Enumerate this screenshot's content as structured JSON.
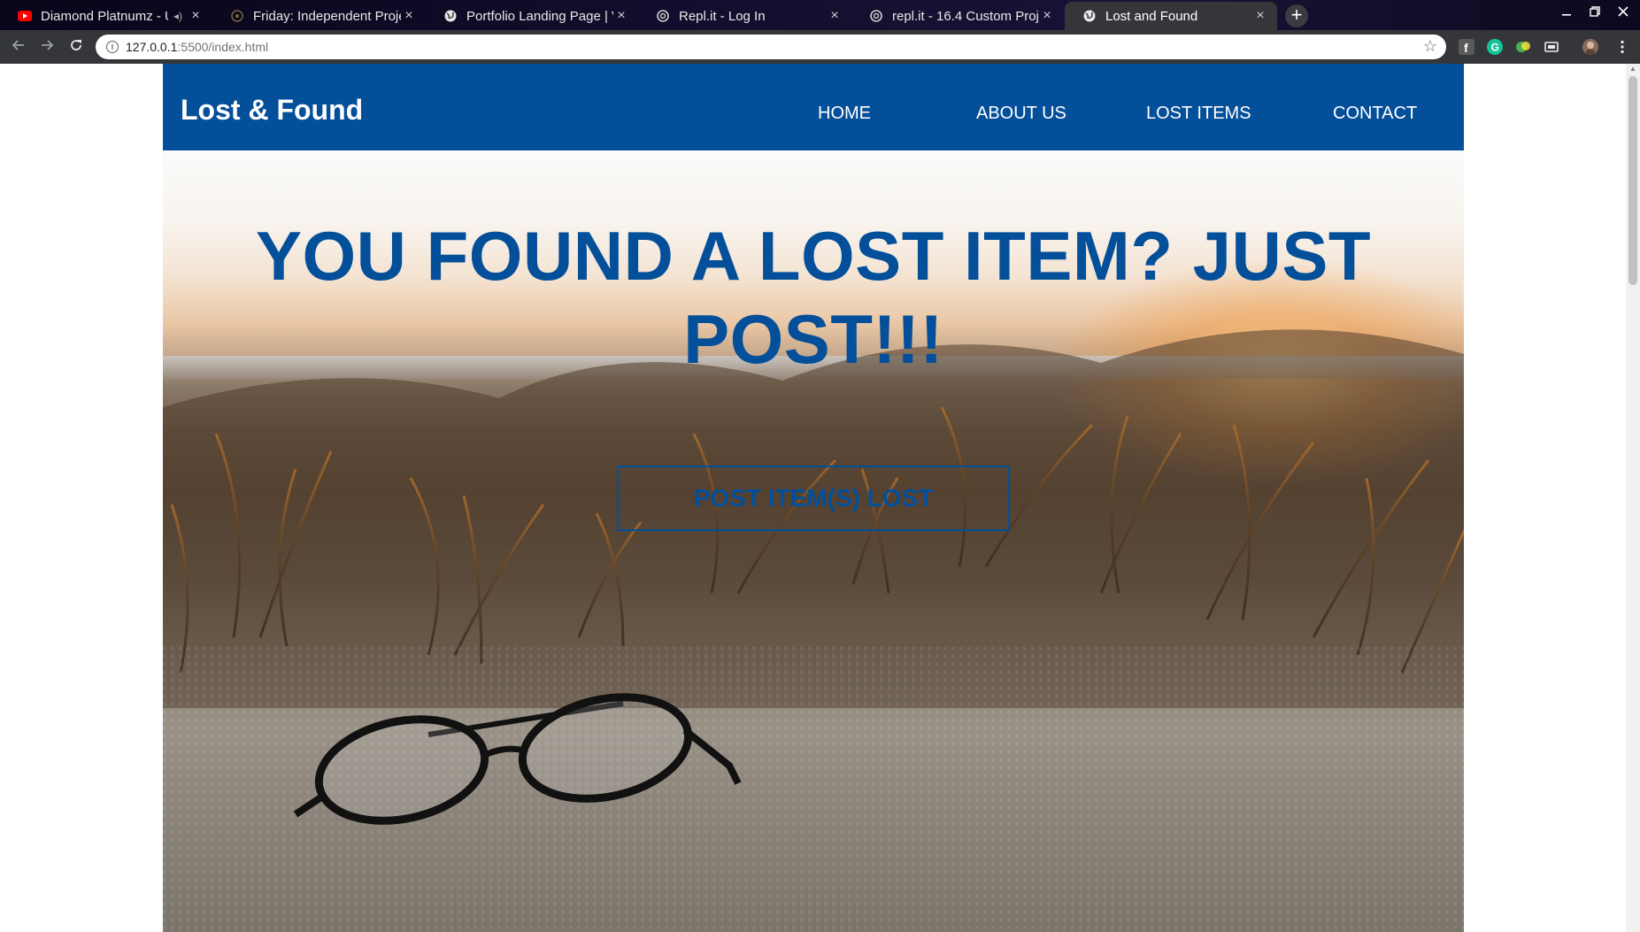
{
  "browser": {
    "tabs": [
      {
        "title": "Diamond Platnumz - U",
        "icon": "youtube-icon",
        "active": false
      },
      {
        "title": "Friday: Independent Proje",
        "icon": "git-icon",
        "active": false
      },
      {
        "title": "Portfolio Landing Page | V",
        "icon": "globe-icon",
        "active": false
      },
      {
        "title": "Repl.it - Log In",
        "icon": "replit-icon",
        "active": false
      },
      {
        "title": "repl.it - 16.4 Custom Proje",
        "icon": "replit-icon",
        "active": false
      },
      {
        "title": "Lost and Found",
        "icon": "globe-icon",
        "active": true
      }
    ],
    "address": {
      "host": "127.0.0.1",
      "path": ":5500/index.html"
    },
    "close_glyph": "×",
    "new_tab_glyph": "+",
    "colors": {
      "tabstrip": "#0b0a1f",
      "toolbar": "#35363a"
    }
  },
  "site": {
    "brand": "Lost & Found",
    "nav": {
      "home": "HOME",
      "about": "ABOUT US",
      "lost": "LOST ITEMS",
      "contact": "CONTACT"
    },
    "hero": {
      "title": "YOU FOUND A LOST ITEM? JUST POST!!!",
      "button": "POST ITEM(S) LOST"
    },
    "colors": {
      "primary": "#044f9a",
      "header_text": "#ffffff"
    }
  }
}
